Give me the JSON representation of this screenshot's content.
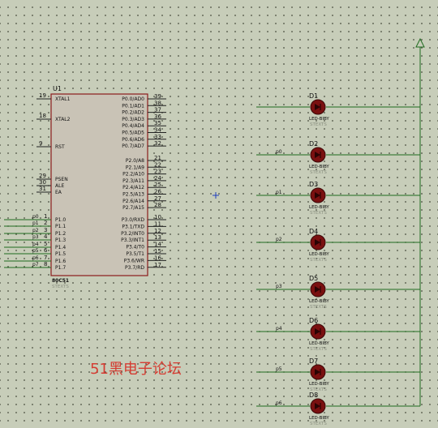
{
  "mcu": {
    "ref": "U1",
    "part": "80C51",
    "sub": "STEXTS",
    "left_pins": [
      {
        "num": "19",
        "name": "XTAL1"
      },
      {
        "num": "18",
        "name": "XTAL2"
      },
      {
        "num": "9",
        "name": "RST"
      },
      {
        "num": "29",
        "name": "PSEN"
      },
      {
        "num": "30",
        "name": "ALE"
      },
      {
        "num": "31",
        "name": "EA"
      },
      {
        "num": "1",
        "name": "P1.0",
        "net": "p0"
      },
      {
        "num": "2",
        "name": "P1.1",
        "net": "p1"
      },
      {
        "num": "3",
        "name": "P1.2",
        "net": "p2"
      },
      {
        "num": "4",
        "name": "P1.3",
        "net": "p3"
      },
      {
        "num": "5",
        "name": "P1.4",
        "net": "p4"
      },
      {
        "num": "6",
        "name": "P1.5",
        "net": "p5"
      },
      {
        "num": "7",
        "name": "P1.6",
        "net": "p6"
      },
      {
        "num": "8",
        "name": "P1.7",
        "net": "p7"
      }
    ],
    "right_pins": [
      {
        "num": "39",
        "name": "P0.0/AD0"
      },
      {
        "num": "38",
        "name": "P0.1/AD1"
      },
      {
        "num": "37",
        "name": "P0.2/AD2"
      },
      {
        "num": "36",
        "name": "P0.3/AD3"
      },
      {
        "num": "35",
        "name": "P0.4/AD4"
      },
      {
        "num": "34",
        "name": "P0.5/AD5"
      },
      {
        "num": "33",
        "name": "P0.6/AD6"
      },
      {
        "num": "32",
        "name": "P0.7/AD7"
      },
      {
        "num": "21",
        "name": "P2.0/A8"
      },
      {
        "num": "22",
        "name": "P2.1/A9"
      },
      {
        "num": "23",
        "name": "P2.2/A10"
      },
      {
        "num": "24",
        "name": "P2.3/A11"
      },
      {
        "num": "25",
        "name": "P2.4/A12"
      },
      {
        "num": "26",
        "name": "P2.5/A13"
      },
      {
        "num": "27",
        "name": "P2.6/A14"
      },
      {
        "num": "28",
        "name": "P2.7/A15"
      },
      {
        "num": "10",
        "name": "P3.0/RXD"
      },
      {
        "num": "11",
        "name": "P3.1/TXD"
      },
      {
        "num": "12",
        "name": "P3.2/INT0"
      },
      {
        "num": "13",
        "name": "P3.3/INT1"
      },
      {
        "num": "14",
        "name": "P3.4/T0"
      },
      {
        "num": "15",
        "name": "P3.5/T1"
      },
      {
        "num": "16",
        "name": "P3.6/WR"
      },
      {
        "num": "17",
        "name": "P3.7/RD"
      }
    ]
  },
  "leds": [
    {
      "ref": "D1",
      "type": "LED-BIBY",
      "sub": "STEXTS",
      "net": ""
    },
    {
      "ref": "D2",
      "type": "LED-BIBY",
      "sub": "STEXTS",
      "net": "p0"
    },
    {
      "ref": "D3",
      "type": "LED-BIBY",
      "sub": "STEXTS",
      "net": "p1"
    },
    {
      "ref": "D4",
      "type": "LED-BIBY",
      "sub": "STEXTS",
      "net": "p2"
    },
    {
      "ref": "D5",
      "type": "LED-BIBY",
      "sub": "STEXTS",
      "net": "p3"
    },
    {
      "ref": "D6",
      "type": "LED-BIBY",
      "sub": "STEXTS",
      "net": "p4"
    },
    {
      "ref": "D7",
      "type": "LED-BIBY",
      "sub": "STEXTS",
      "net": "p5"
    },
    {
      "ref": "D8",
      "type": "LED-BIBY",
      "sub": "STEXTS",
      "net": "p6"
    }
  ],
  "watermark": "51黑电子论坛",
  "colors": {
    "background": "#c7cdb9",
    "wire": "#1f6b1f",
    "chip_fill": "#c9c3b6",
    "chip_border": "#8b1c1c",
    "led": "#7a1010",
    "watermark": "#d53c32"
  }
}
